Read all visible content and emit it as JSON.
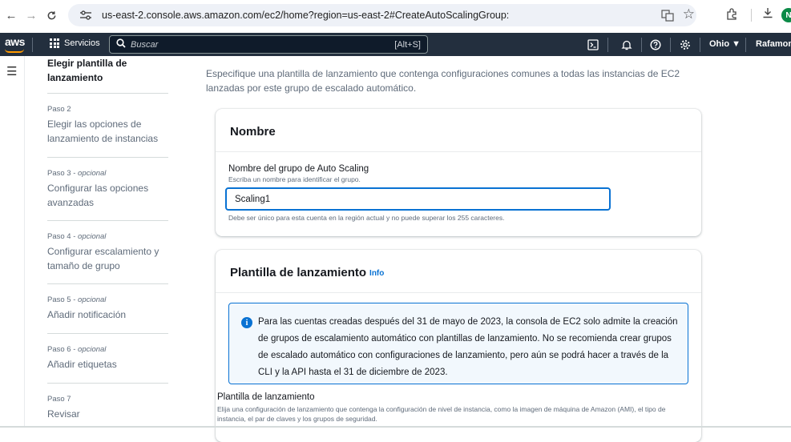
{
  "browser": {
    "url_host": "us-east-2.console.aws.amazon.com",
    "url_path": "/ec2/home?region=us-east-2#CreateAutoScalingGroup:",
    "avatar_initial": "N"
  },
  "aws_nav": {
    "logo": "aws",
    "services_label": "Servicios",
    "search_placeholder": "Buscar",
    "search_shortcut": "[Alt+S]",
    "region": "Ohio ▼",
    "account": "Rafamonte"
  },
  "steps": [
    {
      "label": "",
      "optional": "",
      "text": "Elegir plantilla de lanzamiento"
    },
    {
      "label": "Paso 2",
      "optional": "",
      "text": "Elegir las opciones de lanzamiento de instancias"
    },
    {
      "label": "Paso 3 - ",
      "optional": "opcional",
      "text": "Configurar las opciones avanzadas"
    },
    {
      "label": "Paso 4 - ",
      "optional": "opcional",
      "text": "Configurar escalamiento y tamaño de grupo"
    },
    {
      "label": "Paso 5 - ",
      "optional": "opcional",
      "text": "Añadir notificación"
    },
    {
      "label": "Paso 6 - ",
      "optional": "opcional",
      "text": "Añadir etiquetas"
    },
    {
      "label": "Paso 7",
      "optional": "",
      "text": "Revisar"
    }
  ],
  "main": {
    "intro": "Especifique una plantilla de lanzamiento que contenga configuraciones comunes a todas las instancias de EC2 lanzadas por este grupo de escalado automático.",
    "name_card": {
      "title": "Nombre",
      "field_label": "Nombre del grupo de Auto Scaling",
      "field_desc": "Escriba un nombre para identificar el grupo.",
      "field_value": "Scaling1",
      "constraint": "Debe ser único para esta cuenta en la región actual y no puede superar los 255 caracteres."
    },
    "template_card": {
      "title": "Plantilla de lanzamiento",
      "info": "Info",
      "notice": "Para las cuentas creadas después del 31 de mayo de 2023, la consola de EC2 solo admite la creación de grupos de escalamiento automático con plantillas de lanzamiento. No se recomienda crear grupos de escalado automático con configuraciones de lanzamiento, pero aún se podrá hacer a través de la CLI y la API hasta el 31 de diciembre de 2023.",
      "field_label": "Plantilla de lanzamiento",
      "field_desc": "Elija una configuración de lanzamiento que contenga la configuración de nivel de instancia, como la imagen de máquina de Amazon (AMI), el tipo de instancia, el par de claves y los grupos de seguridad."
    }
  },
  "colors": {
    "aws_nav_bg": "#232f3e",
    "accent": "#0972d3",
    "aws_orange": "#ff9900"
  }
}
